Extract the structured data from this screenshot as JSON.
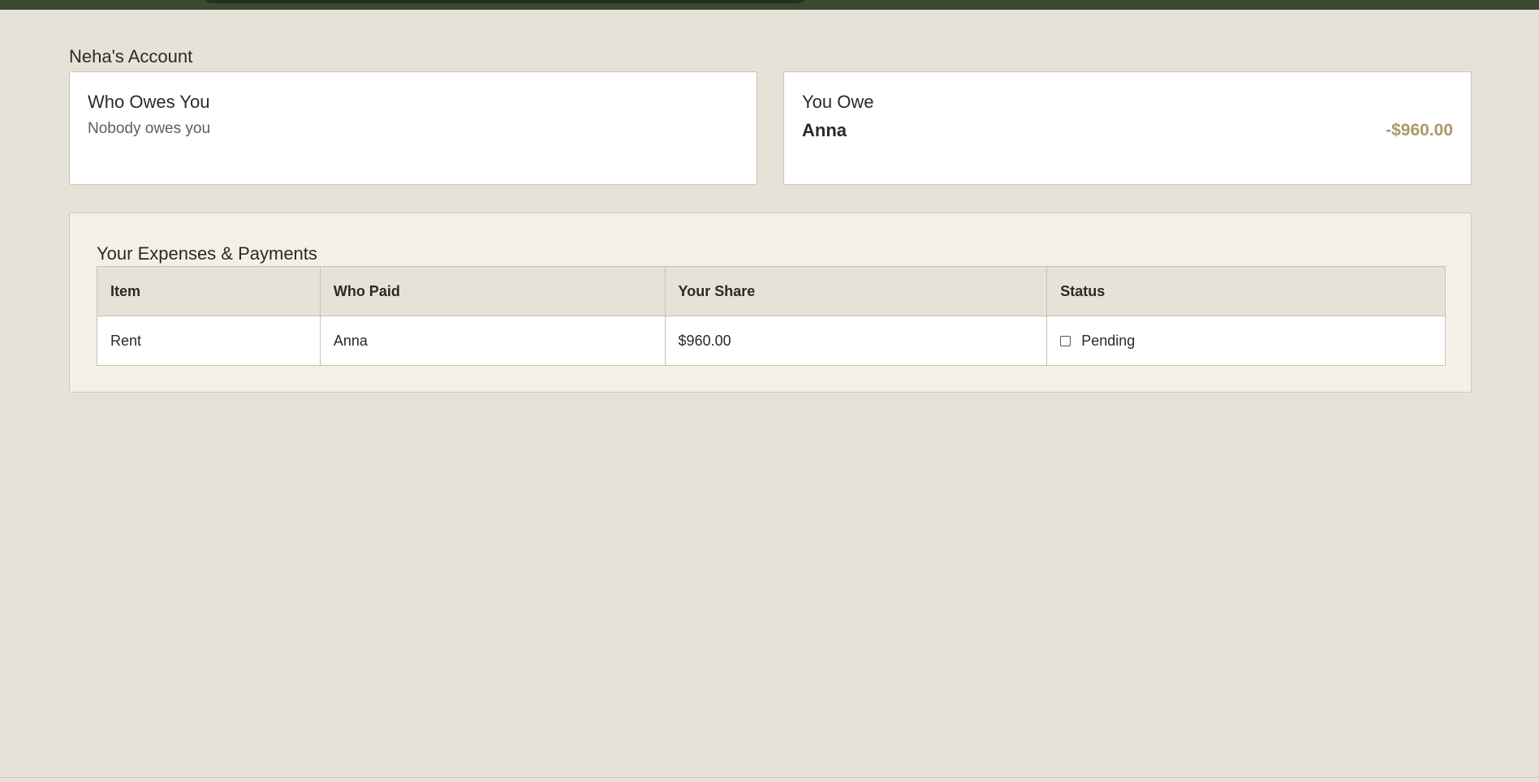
{
  "account": {
    "title": "Neha's Account"
  },
  "who_owes_you": {
    "title": "Who Owes You",
    "empty_text": "Nobody owes you"
  },
  "you_owe": {
    "title": "You Owe",
    "entries": [
      {
        "name": "Anna",
        "amount": "-$960.00"
      }
    ]
  },
  "expenses": {
    "title": "Your Expenses & Payments",
    "columns": [
      "Item",
      "Who Paid",
      "Your Share",
      "Status"
    ],
    "rows": [
      {
        "item": "Rent",
        "who_paid": "Anna",
        "your_share": "$960.00",
        "status": "Pending",
        "settled": false
      }
    ]
  },
  "colors": {
    "background": "#e7e2d7",
    "topbar": "#3a4a30",
    "amount_owed": "#ab9a68",
    "card_border": "#cfc3b1"
  }
}
